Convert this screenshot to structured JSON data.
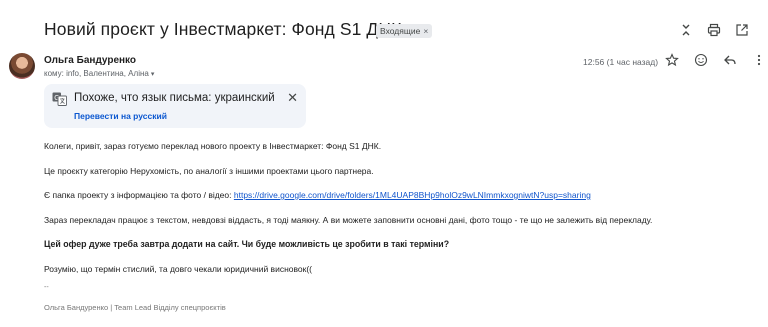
{
  "subject": "Новий проєкт у Інвестмаркет: Фонд S1 ДНК",
  "label": {
    "text": "Входящие",
    "remove": "×"
  },
  "sender": {
    "name": "Ольга Бандуренко",
    "recipients": "кому: info, Валентина, Аліна",
    "recipients_caret": "▾",
    "time": "12:56 (1 час назад)"
  },
  "translate": {
    "message": "Похоже, что язык письма: украинский",
    "action": "Перевести на русский",
    "close": "✕"
  },
  "body": {
    "line1": "Колеги, привіт, зараз готуємо переклад нового проекту в Інвестмаркет: Фонд S1 ДНК.",
    "line2": "Це проєкту  категорію Нерухомість, по аналогії з іншими проектами цього партнера.",
    "line3_prefix": "Є папка проекту з інформацією та фото / відео: ",
    "line3_link": "https://drive.google.com/drive/folders/1ML4UAP8BHp9holOz9wLNImmkxogniwtN?usp=sharing",
    "line4": "Зараз перекладач працює з текстом, невдовзі віддасть, я тоді маякну. А ви можете заповнити основні дані, фото тощо - те що не залежить від перекладу.",
    "line5": "Цей офер дуже треба завтра додати на сайт. Чи буде можливість це зробити в такі терміни?",
    "line6": "Розумію, що термін стислий, та довго чекали юридичний висновок((",
    "dash": "--",
    "signature": "Ольга Бандуренко | Team Lead Відділу спецпроєктів"
  }
}
